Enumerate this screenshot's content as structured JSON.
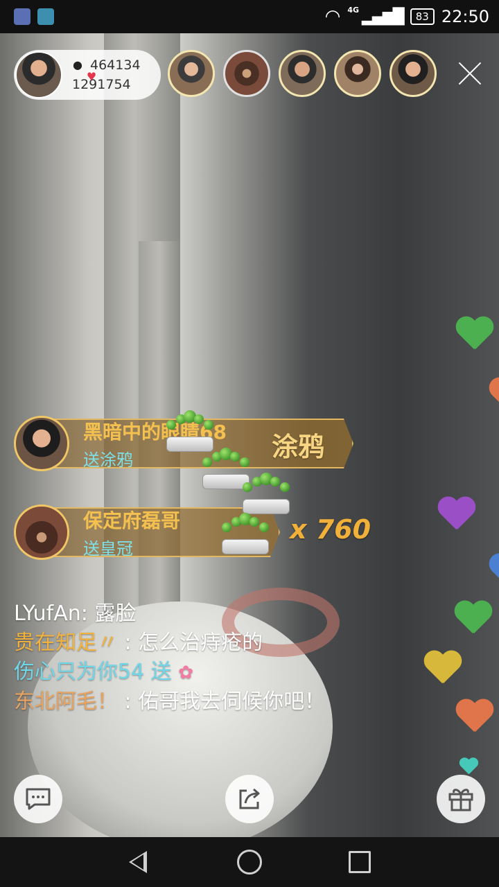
{
  "status_bar": {
    "network": "4G",
    "battery": "83",
    "time": "22:50"
  },
  "anchor": {
    "followers": "464134",
    "likes": "1291754"
  },
  "gifts": [
    {
      "sender": "黑暗中的眼睛68",
      "action": "送涂鸦",
      "gift_name": "涂鸦"
    },
    {
      "sender": "保定府磊哥",
      "action": "送皇冠",
      "count": "x 760"
    }
  ],
  "chat": [
    {
      "user": "LYufAn",
      "sep": ": ",
      "text": "露脸"
    },
    {
      "user": "贵在知足〃",
      "sep": " : ",
      "text": "怎么治痔疮的"
    },
    {
      "user": "伤心只为你54",
      "sep": " ",
      "text": "送"
    },
    {
      "user": "东北阿毛！",
      "sep": " : ",
      "text": "佑哥我去伺候你吧！"
    }
  ],
  "colors": {
    "gold": "#f2b23e",
    "cyan": "#6fd7e8",
    "heart_green": "#4caf50",
    "heart_purple": "#9b4fc6",
    "heart_yellow": "#d8b83a",
    "heart_orange": "#e0744b",
    "heart_teal": "#46c9b8"
  },
  "icons": {
    "chat": "chat-bubble-icon",
    "share": "share-icon",
    "gift": "gift-icon",
    "close": "close-icon"
  }
}
